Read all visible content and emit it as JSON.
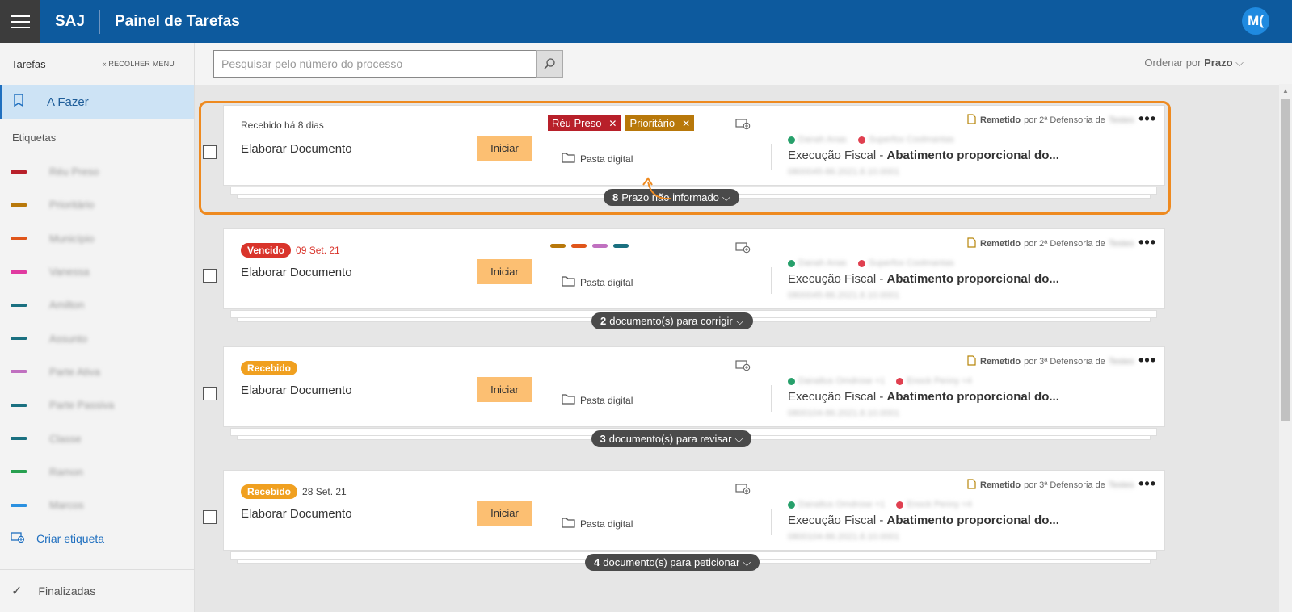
{
  "header": {
    "logo": "SAJ",
    "title": "Painel de Tarefas",
    "avatar_initials": "M("
  },
  "sidebar": {
    "title": "Tarefas",
    "collapse_label": "RECOLHER MENU",
    "active_item": "A Fazer",
    "tags_section": "Etiquetas",
    "tags": [
      {
        "name": "Réu Preso",
        "color": "#b8202a"
      },
      {
        "name": "Prioritário",
        "color": "#b8780a"
      },
      {
        "name": "Município",
        "color": "#e0551a"
      },
      {
        "name": "Vanessa",
        "color": "#e03aa0"
      },
      {
        "name": "Amilton",
        "color": "#1a7080"
      },
      {
        "name": "Assunto",
        "color": "#1a7080"
      },
      {
        "name": "Parte Ativa",
        "color": "#c070c0"
      },
      {
        "name": "Parte Passiva",
        "color": "#1a7080"
      },
      {
        "name": "Classe",
        "color": "#1a7080"
      },
      {
        "name": "Ramon",
        "color": "#28a050"
      },
      {
        "name": "Marcos",
        "color": "#2a90e0"
      }
    ],
    "create_tag": "Criar etiqueta",
    "finished": "Finalizadas"
  },
  "toolbar": {
    "search_placeholder": "Pesquisar pelo número do processo",
    "sort_label": "Ordenar por",
    "sort_value": "Prazo"
  },
  "cards": [
    {
      "status_text": "Recebido há 8 dias",
      "title": "Elaborar Documento",
      "start_label": "Iniciar",
      "folder_label": "Pasta digital",
      "tags": [
        {
          "label": "Réu Preso",
          "color": "#b8202a"
        },
        {
          "label": "Prioritário",
          "color": "#b8780a"
        }
      ],
      "remetido_label": "Remetido",
      "remetido_by": "por 2ª Defensoria de",
      "remetido_loc": "Testes",
      "party_a": "Danah Anas",
      "party_b": "Superfox Coolmantas",
      "proc_class": "Execução Fiscal - ",
      "proc_subject": "Abatimento proporcional do...",
      "proc_number": "0800045-86.2021.8.10.0001",
      "badge_count": "8",
      "badge_text": "Prazo não informado"
    },
    {
      "pill": "Vencido",
      "pill_color": "#d9342b",
      "date": "09 Set. 21",
      "title": "Elaborar Documento",
      "start_label": "Iniciar",
      "folder_label": "Pasta digital",
      "mini_tags": [
        "#b8780a",
        "#e0551a",
        "#c070c0",
        "#1a7080"
      ],
      "remetido_label": "Remetido",
      "remetido_by": "por 2ª Defensoria de",
      "remetido_loc": "Testes",
      "party_a": "Danah Anas",
      "party_b": "Superfox Coolmantas",
      "proc_class": "Execução Fiscal - ",
      "proc_subject": "Abatimento proporcional do...",
      "proc_number": "0800045-86.2021.8.10.0001",
      "badge_count": "2",
      "badge_text": "documento(s) para corrigir"
    },
    {
      "pill": "Recebido",
      "pill_color": "#f0a020",
      "date": "",
      "title": "Elaborar Documento",
      "start_label": "Iniciar",
      "folder_label": "Pasta digital",
      "remetido_label": "Remetido",
      "remetido_by": "por 3ª Defensoria de",
      "remetido_loc": "Testes",
      "party_a": "Danaltus Omdrose +1",
      "party_b": "Enock Penny +4",
      "proc_class": "Execução Fiscal - ",
      "proc_subject": "Abatimento proporcional do...",
      "proc_number": "0800104-86.2021.8.10.0001",
      "badge_count": "3",
      "badge_text": "documento(s) para revisar"
    },
    {
      "pill": "Recebido",
      "pill_color": "#f0a020",
      "date": "28 Set. 21",
      "title": "Elaborar Documento",
      "start_label": "Iniciar",
      "folder_label": "Pasta digital",
      "remetido_label": "Remetido",
      "remetido_by": "por 3ª Defensoria de",
      "remetido_loc": "Testes",
      "party_a": "Danaltus Omdrose +1",
      "party_b": "Enock Penny +4",
      "proc_class": "Execução Fiscal - ",
      "proc_subject": "Abatimento proporcional do...",
      "proc_number": "0800104-86.2021.8.10.0001",
      "badge_count": "4",
      "badge_text": "documento(s) para peticionar"
    }
  ],
  "colors": {
    "header_bg": "#0d5a9e",
    "accent": "#1f6fbf",
    "start_button": "#fcbf72",
    "highlight": "#ee8a20"
  }
}
